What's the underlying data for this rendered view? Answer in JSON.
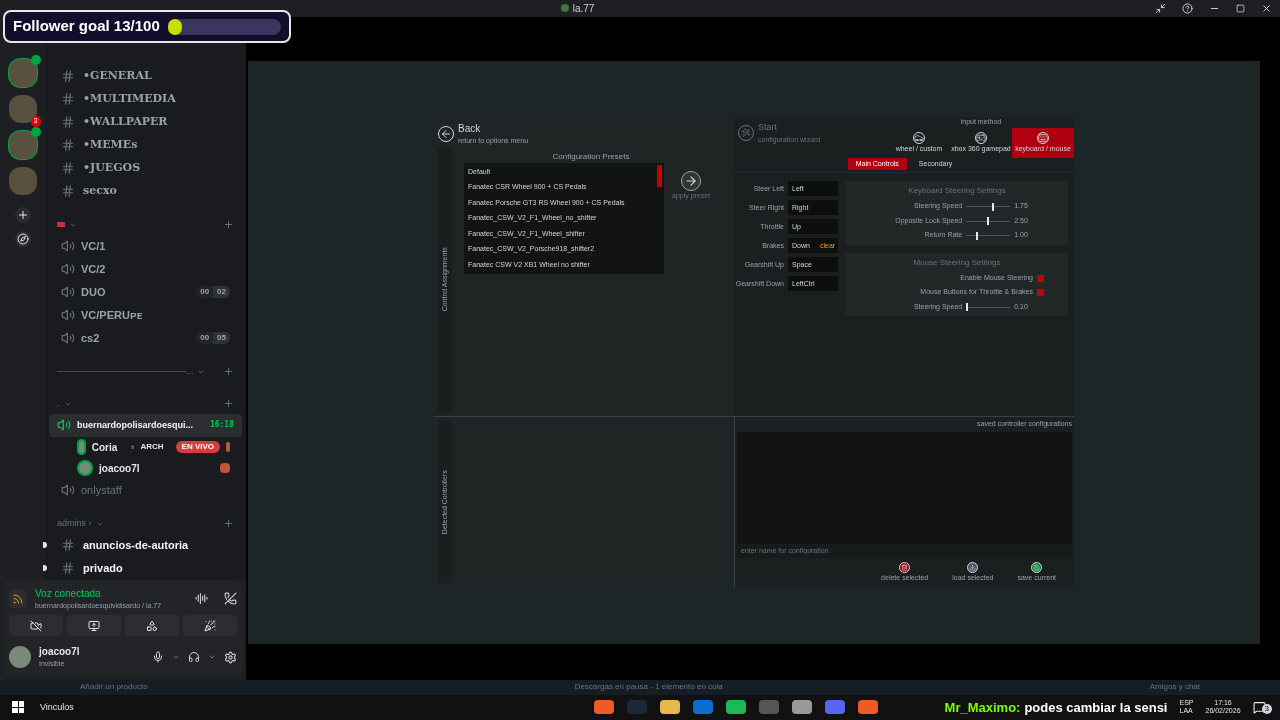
{
  "overlay": {
    "label": "Follower goal 13/100",
    "level": 0.13
  },
  "top_bar": {
    "title": "la.77"
  },
  "servers": [
    {
      "kind": "avatar",
      "speaking": true
    },
    {
      "badge": "3",
      "kind": "avatar",
      "speaking": false
    },
    {
      "kind": "avatar",
      "speaking": true
    },
    {
      "kind": "avatar",
      "speaking": false
    }
  ],
  "channels": [
    {
      "kind": "text",
      "name": "•GENERAL",
      "unread": false
    },
    {
      "kind": "text",
      "name": "•MULTIMEDIA",
      "unread": false
    },
    {
      "kind": "text",
      "name": "•WALLPAPER",
      "unread": false
    },
    {
      "kind": "text",
      "name": "•MEMEs",
      "unread": false
    },
    {
      "kind": "text",
      "name": "•JUEGOS",
      "unread": false
    },
    {
      "kind": "text",
      "name": "secxo",
      "unread": false
    },
    {
      "kind": "category"
    },
    {
      "kind": "voice",
      "name": "VC/1"
    },
    {
      "kind": "voice",
      "name": "VC/2"
    },
    {
      "kind": "voice",
      "name": "DUO",
      "counts": [
        "00",
        "02"
      ]
    },
    {
      "kind": "voice",
      "name": "VC/PERUᴘᴇ"
    },
    {
      "kind": "voice",
      "name": "cs2",
      "counts": [
        "00",
        "05"
      ]
    },
    {
      "kind": "category",
      "name": "-------------------------------------------..."
    },
    {
      "kind": "category",
      "name": "."
    },
    {
      "kind": "voice",
      "name": "buernardopolisardoesqui...",
      "time": "16:18",
      "selected": true
    },
    {
      "kind": "user",
      "name": "Coria",
      "tag": "ARCH",
      "live": "EN VIVO"
    },
    {
      "kind": "user",
      "name": "joacoo7l"
    },
    {
      "kind": "voice",
      "name": "onlystaff",
      "selected": false
    },
    {
      "kind": "category",
      "name": "admins ›"
    },
    {
      "kind": "text",
      "name": "anuncios-de-autoria",
      "unread": true
    },
    {
      "kind": "text",
      "name": "privado",
      "unread": true
    }
  ],
  "voice_panel": {
    "status": "Voz conectada",
    "channel": "buernardopolisardoesquividisardo / la.77"
  },
  "user_panel": {
    "name": "joacoo7l",
    "status": "Invisible"
  },
  "game": {
    "back": {
      "label": "Back",
      "sub": "return to options menu"
    },
    "side_label_top": "Control Assignments",
    "side_label_bottom": "Detected Controllers",
    "presets_title": "Configuration Presets",
    "presets": [
      "Default",
      "Fanatec CSR Wheel 900 + CS Pedals",
      "Fanatec Porsche GT3 RS Wheel 900 + CS Pedals",
      "Fanatec_CSW_V2_F1_Wheel_no_shifter",
      "Fanatec_CSW_V2_F1_Wheel_shifter",
      "Fanatec_CSW_V2_Porsche918_shifter2",
      "Fanatec CSW V2 XB1 Wheel no shifter"
    ],
    "apply": "apply preset",
    "start": {
      "label": "Start",
      "sub": "configuration wizard"
    },
    "input_method": "input method",
    "modes": [
      {
        "label": "wheel / custom",
        "selected": false
      },
      {
        "label": "xbox 360 gamepad",
        "selected": false
      },
      {
        "label": "keyboard / mouse",
        "selected": true
      }
    ],
    "tabs": [
      {
        "label": "Main Controls",
        "selected": true
      },
      {
        "label": "Secondary",
        "selected": false
      }
    ],
    "bindings": [
      {
        "action": "Steer Left",
        "key": "Left"
      },
      {
        "action": "Steer Right",
        "key": "Right"
      },
      {
        "action": "Throttle",
        "key": "Up"
      },
      {
        "action": "Brakes",
        "key": "Down",
        "hint": "clear"
      },
      {
        "action": "Gearshift Up",
        "key": "Space"
      },
      {
        "action": "Gearshift Down",
        "key": "LeftCtrl"
      }
    ],
    "keyboard": {
      "title": "Keyboard Steering Settings",
      "sliders": [
        {
          "label": "Steering Speed",
          "level": 0.62,
          "reading": "1.75"
        },
        {
          "label": "Opposite Lock Speed",
          "level": 0.5,
          "reading": "2.50"
        },
        {
          "label": "Return Rate",
          "level": 0.25,
          "reading": "1.00"
        }
      ]
    },
    "mouse": {
      "title": "Mouse Steering Settings",
      "checks": [
        {
          "label": "Enable Mouse Steering",
          "checked": true
        },
        {
          "label": "Mouse Buttons for Throttle & Brakes",
          "checked": true
        }
      ],
      "slider": {
        "label": "Steering Speed",
        "level": 0.02,
        "reading": "0.10"
      }
    },
    "saved_title": "saved controller configurations",
    "name_placeholder": "enter name for configuration",
    "actions": [
      {
        "label": "delete selected",
        "kind": "delete"
      },
      {
        "label": "load selected",
        "kind": "load"
      },
      {
        "label": "save current",
        "kind": "save"
      }
    ]
  },
  "steam_bar": {
    "left": "Añadir un producto",
    "center": "Descargas en pausa - 1 elemento en cola",
    "right": "Amigos y chat"
  },
  "taskbar": {
    "links": "Vinculos",
    "chat_user": "Mr_Maximo:",
    "chat_text": "podes cambiar la sensi",
    "lang1": "ESP",
    "lang2": "LAA",
    "time": "17:16",
    "date": "26/02/2026",
    "notifications": "3"
  }
}
